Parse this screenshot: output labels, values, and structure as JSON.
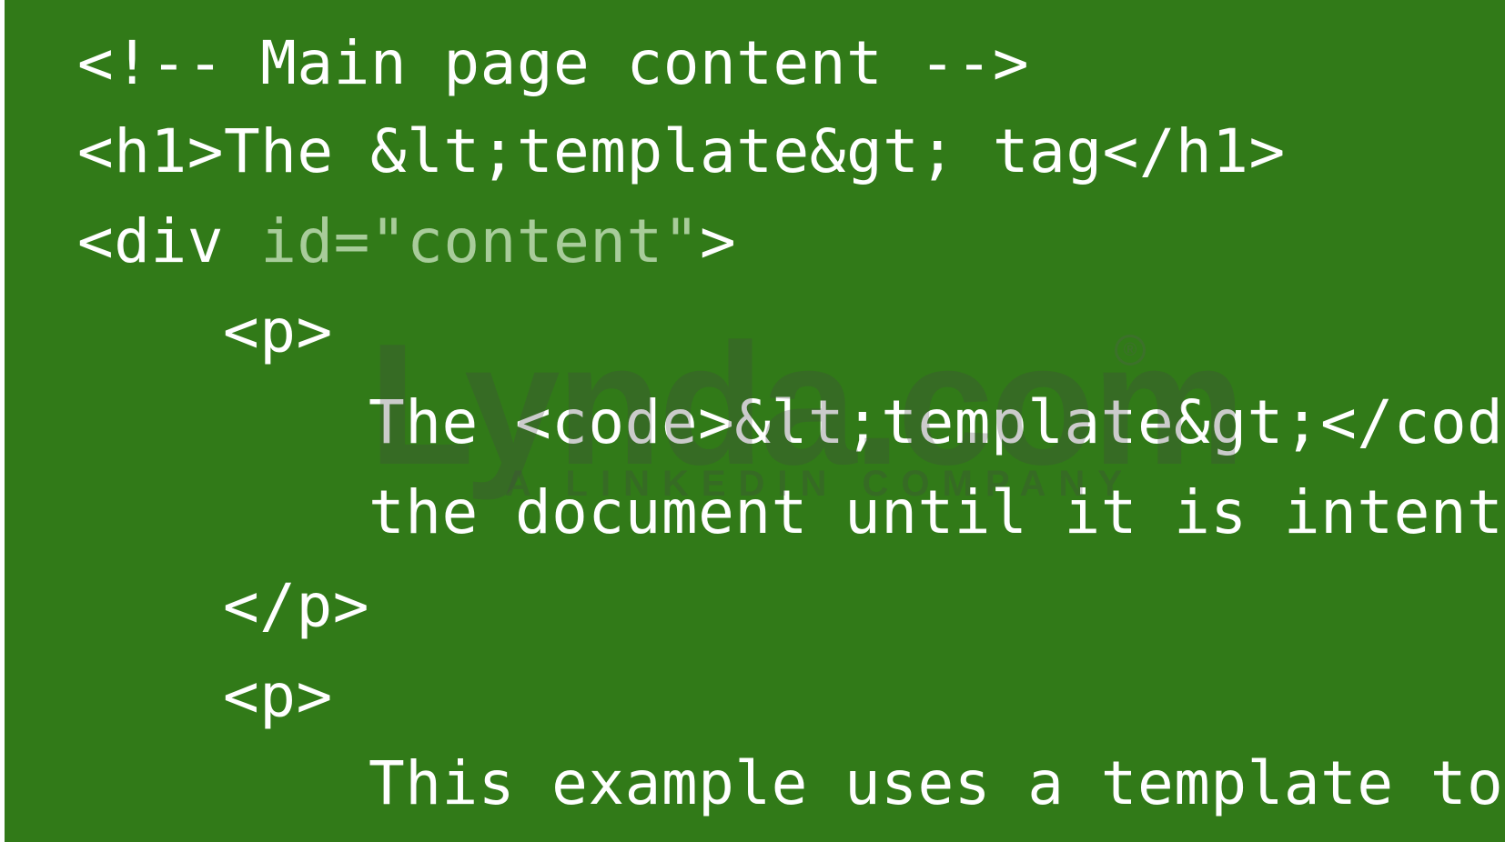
{
  "code": {
    "line0": "<!-- Main page content -->",
    "line1": "<h1>The &lt;template&gt; tag</h1>",
    "line2": {
      "tag_open": "<div ",
      "attr": "id=\"content\"",
      "tag_close": ">"
    },
    "line3": "<p>",
    "line4": "The <code>&lt;template&gt;</cod",
    "line5": "the document until it is intent",
    "line6": "</p>",
    "line7": "<p>",
    "line8": "This example uses a template to"
  },
  "watermark": {
    "logo": "Lynda.com",
    "tagline": "A LINKEDIN COMPANY",
    "registered": "®"
  },
  "colors": {
    "background": "#317a18",
    "text": "#ffffff",
    "attribute": "#a8cc9a"
  }
}
